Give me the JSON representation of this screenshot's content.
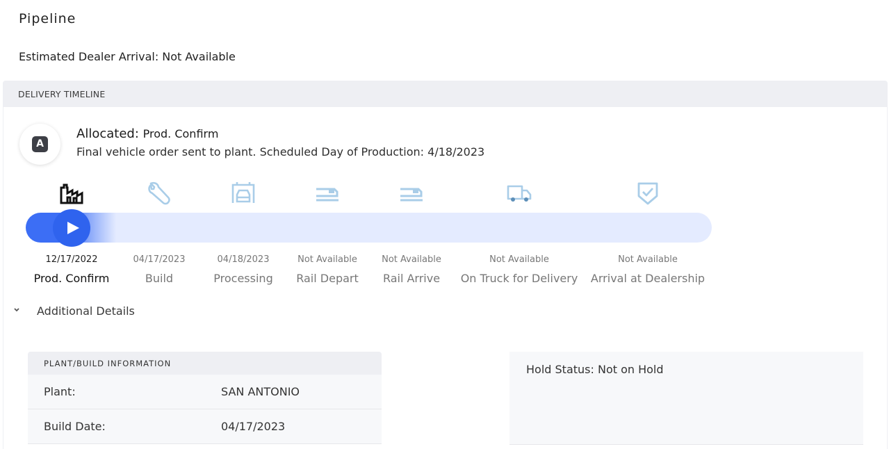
{
  "page": {
    "title": "Pipeline",
    "eta_label": "Estimated Dealer Arrival: Not Available"
  },
  "timeline": {
    "header": "DELIVERY TIMELINE",
    "status": {
      "badge_letter": "A",
      "label": "Allocated:",
      "stage": "Prod. Confirm",
      "description": "Final vehicle order sent to plant. Scheduled Day of Production: 4/18/2023"
    },
    "progress_fraction": 0.09,
    "colors": {
      "accent": "#2f63ee",
      "track": "#e4ebff",
      "icon_inactive": "#a9cde8",
      "icon_active": "#111111"
    },
    "stages": [
      {
        "name": "Prod. Confirm",
        "date": "12/17/2022",
        "icon": "factory-icon",
        "active": true
      },
      {
        "name": "Build",
        "date": "04/17/2023",
        "icon": "wrench-icon",
        "active": false
      },
      {
        "name": "Processing",
        "date": "04/18/2023",
        "icon": "car-wash-icon",
        "active": false
      },
      {
        "name": "Rail Depart",
        "date": "Not Available",
        "icon": "rail-car-icon",
        "active": false
      },
      {
        "name": "Rail Arrive",
        "date": "Not Available",
        "icon": "rail-car-icon",
        "active": false
      },
      {
        "name": "On Truck for Delivery",
        "date": "Not Available",
        "icon": "truck-icon",
        "active": false
      },
      {
        "name": "Arrival at Dealership",
        "date": "Not Available",
        "icon": "shield-check-icon",
        "active": false
      }
    ]
  },
  "details": {
    "toggle_label": "Additional Details",
    "plant_card": {
      "header": "PLANT/BUILD INFORMATION",
      "rows": [
        {
          "label": "Plant:",
          "value": "SAN ANTONIO"
        },
        {
          "label": "Build Date:",
          "value": "04/17/2023"
        }
      ]
    },
    "hold_status": "Hold Status: Not on Hold"
  }
}
